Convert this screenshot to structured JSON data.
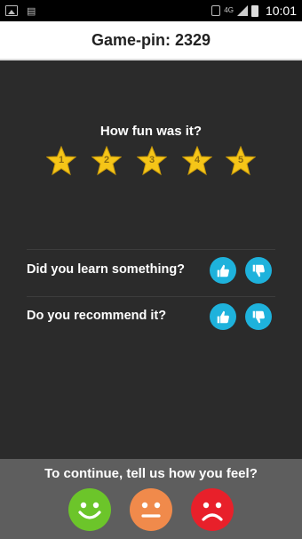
{
  "status_bar": {
    "network_type": "4G",
    "time": "10:01",
    "icons": [
      "image-icon",
      "download-icon",
      "vibrate-icon",
      "signal-icon",
      "battery-icon"
    ]
  },
  "header": {
    "title": "Game-pin: 2329"
  },
  "rating": {
    "question": "How fun was it?",
    "stars": [
      "1",
      "2",
      "3",
      "4",
      "5"
    ],
    "star_color": "#f5c518"
  },
  "questions": [
    {
      "label": "Did you learn something?"
    },
    {
      "label": "Do you recommend it?"
    }
  ],
  "thumb_color": "#1eb2dc",
  "feedback": {
    "prompt": "To continue, tell us how you feel?",
    "faces": [
      {
        "icon": "happy-face-icon",
        "color": "#6cc52a"
      },
      {
        "icon": "neutral-face-icon",
        "color": "#f08a4b"
      },
      {
        "icon": "sad-face-icon",
        "color": "#e8202a"
      }
    ]
  }
}
